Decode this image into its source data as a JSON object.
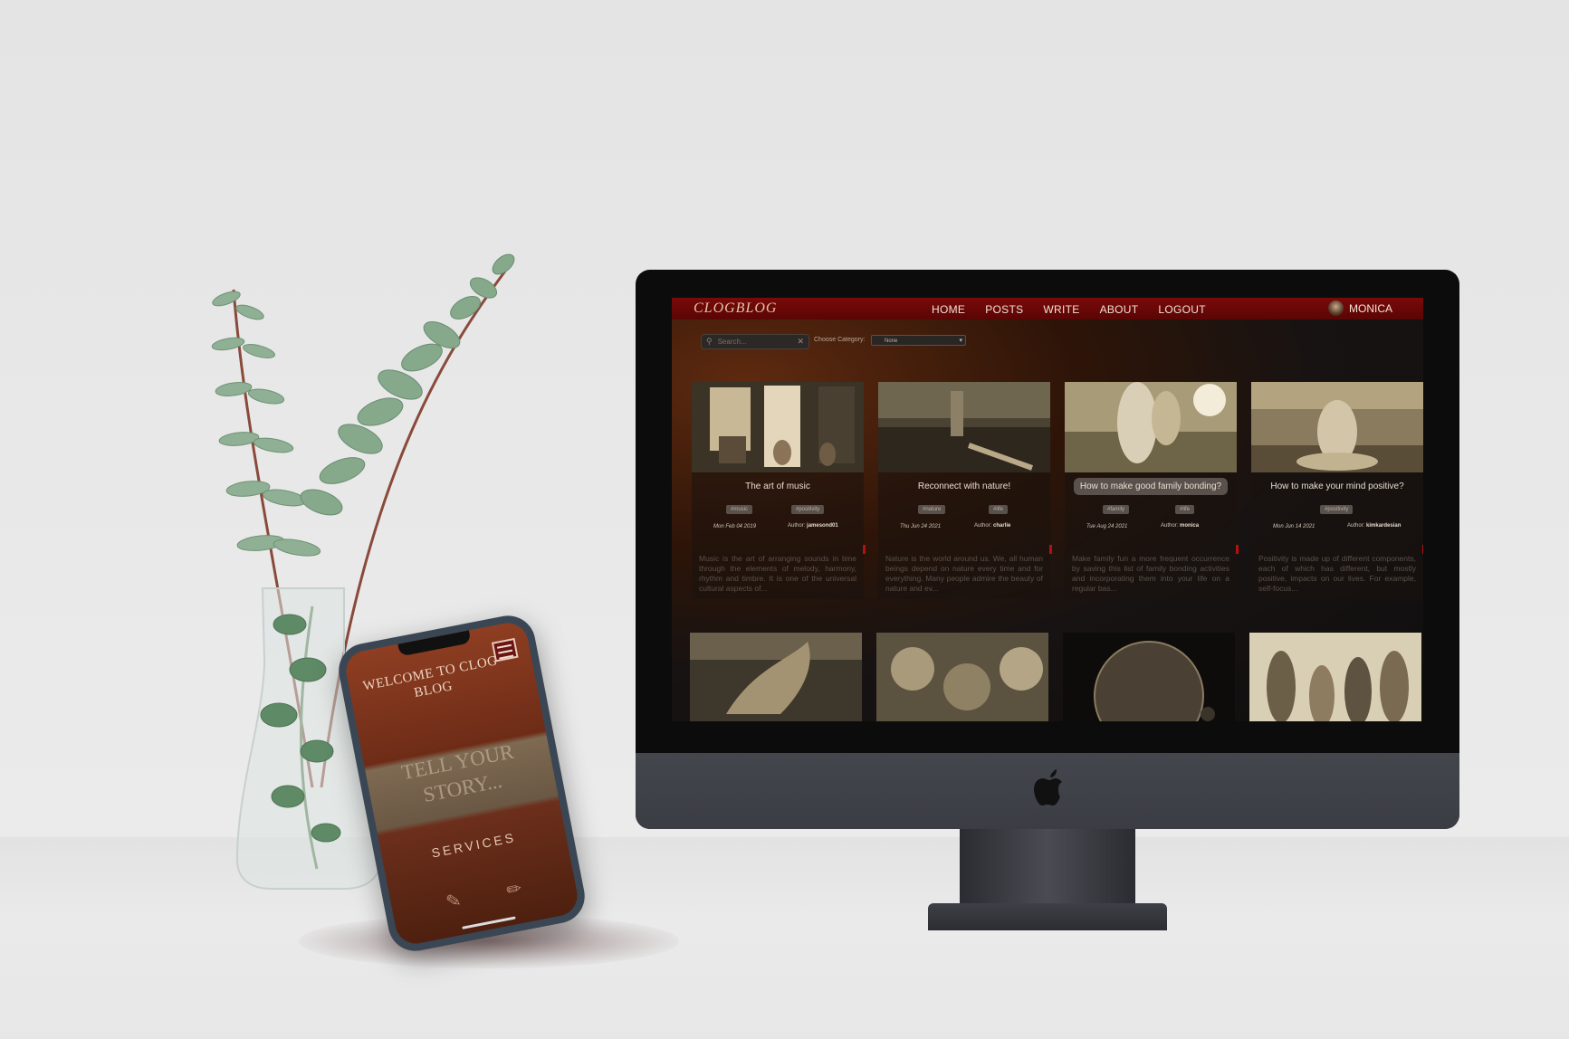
{
  "phone": {
    "welcome": "WELCOME TO CLOG BLOG",
    "hero": "TELL YOUR STORY...",
    "services": "SERVICES",
    "menu_icon": "hamburger-menu-icon",
    "service_icons": [
      "document-edit-icon",
      "pencil-edit-icon"
    ]
  },
  "site": {
    "logo": "CLOGBLOG",
    "nav": [
      "HOME",
      "POSTS",
      "WRITE",
      "ABOUT",
      "LOGOUT"
    ],
    "user": "MONICA",
    "search_placeholder": "Search...",
    "category_label": "Choose Category:",
    "category_selected": "None",
    "accent_color": "#7a0a0a"
  },
  "posts": [
    {
      "title": "The art of music",
      "tags": [
        "#music",
        "#positivity"
      ],
      "date": "Mon Feb 04 2019",
      "author_label": "Author:",
      "author": "jamesond01",
      "excerpt": "Music is the art of arranging sounds in time through the elements of melody, harmony, rhythm and timbre. It is one of the universal cultural aspects of..."
    },
    {
      "title": "Reconnect with nature!",
      "tags": [
        "#nature",
        "#life"
      ],
      "date": "Thu Jun 24 2021",
      "author_label": "Author:",
      "author": "charlie",
      "excerpt": "Nature is the world around us. We, all human beings depend on nature every time and for everything. Many people admire the beauty of nature and ev..."
    },
    {
      "title": "How to make good family bonding?",
      "tags": [
        "#family",
        "#life"
      ],
      "date": "Tue Aug 24 2021",
      "author_label": "Author:",
      "author": "monica",
      "excerpt": "Make family fun a more frequent occurrence by saving this list of family bonding activities and incorporating them into your life on a regular bas..."
    },
    {
      "title": "How to make your mind positive?",
      "tags": [
        "#positivity"
      ],
      "date": "Mon Jun 14 2021",
      "author_label": "Author:",
      "author": "kimkardesian",
      "excerpt": "Positivity is made up of different components, each of which has different, but mostly positive, impacts on our lives. For example, self-focus..."
    }
  ]
}
